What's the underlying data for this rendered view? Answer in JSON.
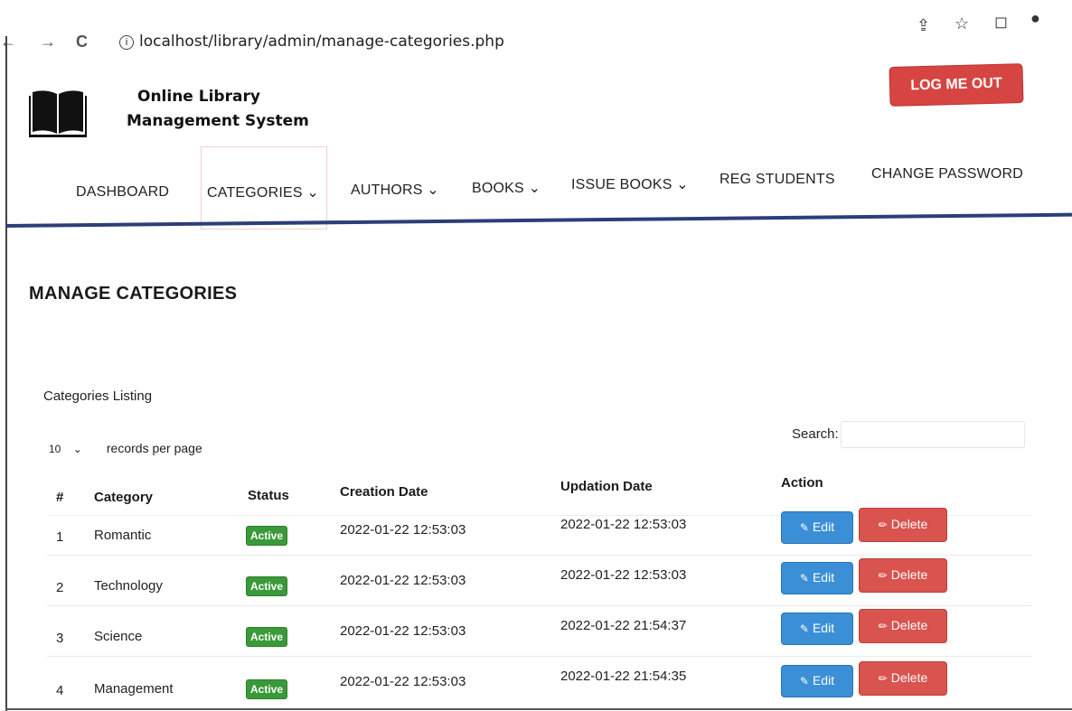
{
  "browser": {
    "url": "localhost/library/admin/manage-categories.php",
    "back_icon": "arrow-left-icon",
    "forward_icon": "arrow-right-icon",
    "reload_icon": "reload-icon",
    "share_icon": "share-icon",
    "bookmark_icon": "star-icon",
    "tab_icon": "window-icon",
    "profile_icon": "profile-icon"
  },
  "header": {
    "brand_line1": "Online Library",
    "brand_line2": "Management System",
    "logout_label": "LOG ME OUT",
    "logo_icon": "open-book-icon"
  },
  "menu": {
    "items": [
      {
        "label": "DASHBOARD",
        "caret": ""
      },
      {
        "label": "CATEGORIES",
        "caret": "⌄"
      },
      {
        "label": "AUTHORS",
        "caret": "⌄"
      },
      {
        "label": "BOOKS",
        "caret": "⌄"
      },
      {
        "label": "ISSUE BOOKS",
        "caret": "⌄"
      },
      {
        "label": "REG STUDENTS",
        "caret": ""
      },
      {
        "label": "CHANGE PASSWORD",
        "caret": ""
      }
    ]
  },
  "page": {
    "title": "MANAGE CATEGORIES",
    "panel_title": "Categories Listing",
    "page_length": "10",
    "page_length_suffix": "records per page",
    "search_label": "Search:"
  },
  "table": {
    "headers": [
      "#",
      "Category",
      "Status",
      "Creation Date",
      "Updation Date",
      "Action"
    ],
    "rows": [
      {
        "num": "1",
        "category": "Romantic",
        "status": "Active",
        "created": "2022-01-22 12:53:03",
        "updated": "2022-01-22 12:53:03"
      },
      {
        "num": "2",
        "category": "Technology",
        "status": "Active",
        "created": "2022-01-22 12:53:03",
        "updated": "2022-01-22 12:53:03"
      },
      {
        "num": "3",
        "category": "Science",
        "status": "Active",
        "created": "2022-01-22 12:53:03",
        "updated": "2022-01-22 21:54:37"
      },
      {
        "num": "4",
        "category": "Management",
        "status": "Active",
        "created": "2022-01-22 12:53:03",
        "updated": "2022-01-22 21:54:35"
      }
    ],
    "edit_label": "Edit",
    "delete_label": "Delete"
  },
  "colors": {
    "logout": "#d64541",
    "menu_border": "#2c3e7a",
    "badge": "#3a9a3a",
    "edit": "#3a8fd6",
    "delete": "#d9534f"
  }
}
